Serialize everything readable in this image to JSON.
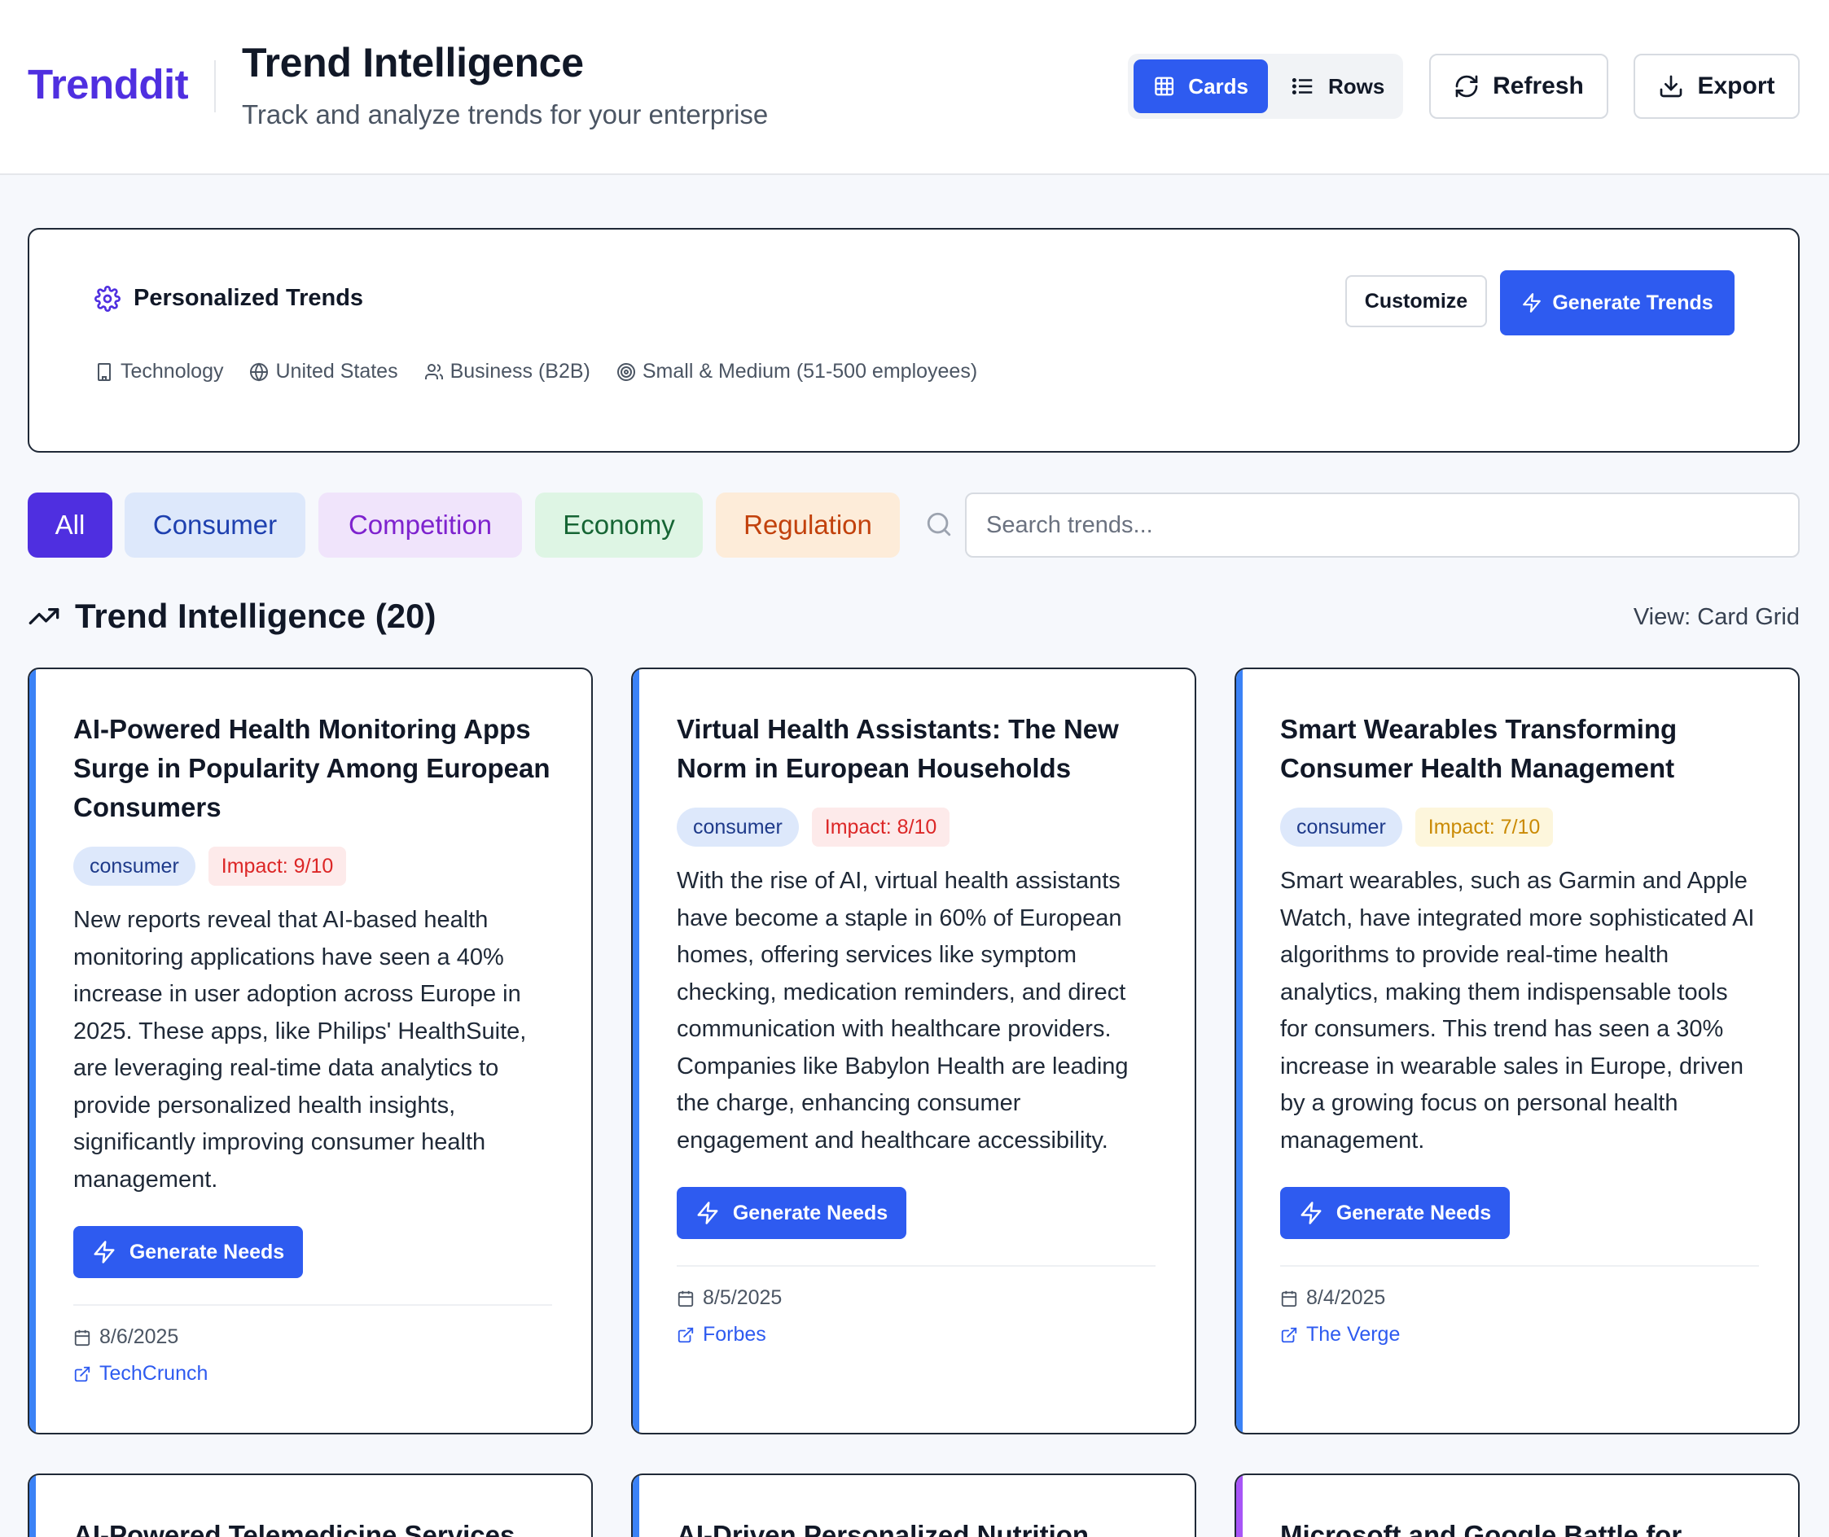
{
  "app": {
    "logo": "Trenddit"
  },
  "header": {
    "title": "Trend Intelligence",
    "subtitle": "Track and analyze trends for your enterprise",
    "view_cards": "Cards",
    "view_rows": "Rows",
    "refresh": "Refresh",
    "export": "Export"
  },
  "panel": {
    "title": "Personalized Trends",
    "customize": "Customize",
    "generate": "Generate Trends",
    "chips": {
      "industry": "Technology",
      "region": "United States",
      "audience": "Business (B2B)",
      "size": "Small & Medium (51-500 employees)"
    }
  },
  "filters": {
    "all": "All",
    "consumer": "Consumer",
    "competition": "Competition",
    "economy": "Economy",
    "regulation": "Regulation",
    "search_placeholder": "Search trends..."
  },
  "section": {
    "title": "Trend Intelligence (20)",
    "view_label": "View: Card Grid"
  },
  "cards": [
    {
      "title": "AI-Powered Health Monitoring Apps Surge in Popularity Among European Consumers",
      "category": "consumer",
      "impact": "Impact: 9/10",
      "description": "New reports reveal that AI-based health monitoring applications have seen a 40% increase in user adoption across Europe in 2025. These apps, like Philips' HealthSuite, are leveraging real-time data analytics to provide personalized health insights, significantly improving consumer health management.",
      "action": "Generate Needs",
      "date": "8/6/2025",
      "source": "TechCrunch"
    },
    {
      "title": "Virtual Health Assistants: The New Norm in European Households",
      "category": "consumer",
      "impact": "Impact: 8/10",
      "description": "With the rise of AI, virtual health assistants have become a staple in 60% of European homes, offering services like symptom checking, medication reminders, and direct communication with healthcare providers. Companies like Babylon Health are leading the charge, enhancing consumer engagement and healthcare accessibility.",
      "action": "Generate Needs",
      "date": "8/5/2025",
      "source": "Forbes"
    },
    {
      "title": "Smart Wearables Transforming Consumer Health Management",
      "category": "consumer",
      "impact": "Impact: 7/10",
      "description": "Smart wearables, such as Garmin and Apple Watch, have integrated more sophisticated AI algorithms to provide real-time health analytics, making them indispensable tools for consumers. This trend has seen a 30% increase in wearable sales in Europe, driven by a growing focus on personal health management.",
      "action": "Generate Needs",
      "date": "8/4/2025",
      "source": "The Verge"
    },
    {
      "title": "AI-Powered Telemedicine Services"
    },
    {
      "title": "AI-Driven Personalized Nutrition"
    },
    {
      "title": "Microsoft and Google Battle for"
    }
  ],
  "colors": {
    "brand": "#4f2fe0",
    "primary": "#2e5bf0",
    "consumer_accent": "#3b82f6",
    "competition_accent": "#a855f7"
  }
}
